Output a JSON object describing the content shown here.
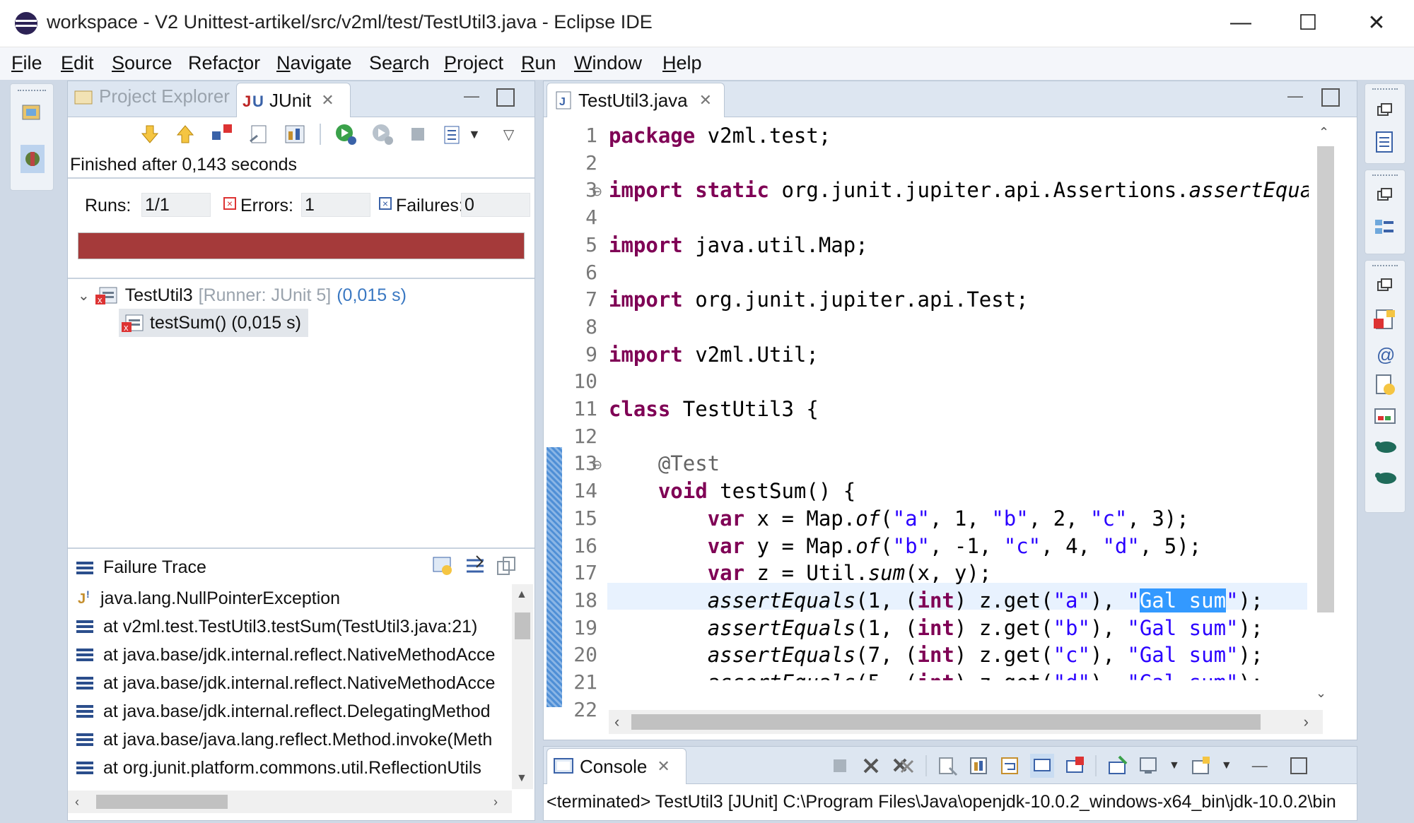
{
  "window": {
    "title": "workspace - V2 Unittest-artikel/src/v2ml/test/TestUtil3.java - Eclipse IDE",
    "minimize_glyph": "—",
    "maximize_glyph": "☐",
    "close_glyph": "✕"
  },
  "menu": [
    "File",
    "Edit",
    "Source",
    "Refactor",
    "Navigate",
    "Search",
    "Project",
    "Run",
    "Window",
    "Help"
  ],
  "menu_mnemonic": [
    "F",
    "E",
    "S",
    "t",
    "N",
    "a",
    "P",
    "R",
    "W",
    "H"
  ],
  "left_panel": {
    "tab_project_explorer": "Project Explorer",
    "tab_junit": "JUnit",
    "status": "Finished after 0,143 seconds",
    "runs_label": "Runs:",
    "runs_value": "1/1",
    "errors_label": "Errors:",
    "errors_value": "1",
    "failures_label": "Failures:",
    "failures_value": "0",
    "progress_color": "#a53a3a",
    "tree": {
      "root_name": "TestUtil3",
      "root_runner": "[Runner: JUnit 5]",
      "root_time": "(0,015 s)",
      "child": "testSum() (0,015 s)"
    },
    "failure_trace_title": "Failure Trace",
    "trace_exception": "java.lang.NullPointerException",
    "trace": [
      "at v2ml.test.TestUtil3.testSum(TestUtil3.java:21)",
      "at java.base/jdk.internal.reflect.NativeMethodAcce",
      "at java.base/jdk.internal.reflect.NativeMethodAcce",
      "at java.base/jdk.internal.reflect.DelegatingMethod",
      "at java.base/java.lang.reflect.Method.invoke(Meth",
      "at org.junit.platform.commons.util.ReflectionUtils"
    ]
  },
  "editor": {
    "tab_label": "TestUtil3.java",
    "line_numbers": [
      "1",
      "2",
      "3",
      "4",
      "5",
      "6",
      "7",
      "8",
      "9",
      "10",
      "11",
      "12",
      "13",
      "14",
      "15",
      "16",
      "17",
      "18",
      "19",
      "20",
      "21",
      "22"
    ]
  },
  "console": {
    "tab_label": "Console",
    "output": "<terminated> TestUtil3 [JUnit] C:\\Program Files\\Java\\openjdk-10.0.2_windows-x64_bin\\jdk-10.0.2\\bin"
  }
}
